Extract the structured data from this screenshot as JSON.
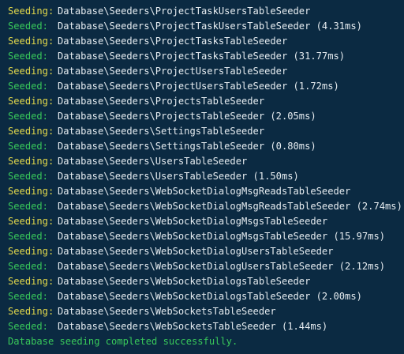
{
  "terminal": {
    "lines": [
      {
        "status": "Seeding:",
        "type": "seeding",
        "text": "Database\\Seeders\\ProjectTaskUsersTableSeeder"
      },
      {
        "status": "Seeded:",
        "type": "seeded",
        "text": "Database\\Seeders\\ProjectTaskUsersTableSeeder (4.31ms)"
      },
      {
        "status": "Seeding:",
        "type": "seeding",
        "text": "Database\\Seeders\\ProjectTasksTableSeeder"
      },
      {
        "status": "Seeded:",
        "type": "seeded",
        "text": "Database\\Seeders\\ProjectTasksTableSeeder (31.77ms)"
      },
      {
        "status": "Seeding:",
        "type": "seeding",
        "text": "Database\\Seeders\\ProjectUsersTableSeeder"
      },
      {
        "status": "Seeded:",
        "type": "seeded",
        "text": "Database\\Seeders\\ProjectUsersTableSeeder (1.72ms)"
      },
      {
        "status": "Seeding:",
        "type": "seeding",
        "text": "Database\\Seeders\\ProjectsTableSeeder"
      },
      {
        "status": "Seeded:",
        "type": "seeded",
        "text": "Database\\Seeders\\ProjectsTableSeeder (2.05ms)"
      },
      {
        "status": "Seeding:",
        "type": "seeding",
        "text": "Database\\Seeders\\SettingsTableSeeder"
      },
      {
        "status": "Seeded:",
        "type": "seeded",
        "text": "Database\\Seeders\\SettingsTableSeeder (0.80ms)"
      },
      {
        "status": "Seeding:",
        "type": "seeding",
        "text": "Database\\Seeders\\UsersTableSeeder"
      },
      {
        "status": "Seeded:",
        "type": "seeded",
        "text": "Database\\Seeders\\UsersTableSeeder (1.50ms)"
      },
      {
        "status": "Seeding:",
        "type": "seeding",
        "text": "Database\\Seeders\\WebSocketDialogMsgReadsTableSeeder"
      },
      {
        "status": "Seeded:",
        "type": "seeded",
        "text": "Database\\Seeders\\WebSocketDialogMsgReadsTableSeeder (2.74ms)"
      },
      {
        "status": "Seeding:",
        "type": "seeding",
        "text": "Database\\Seeders\\WebSocketDialogMsgsTableSeeder"
      },
      {
        "status": "Seeded:",
        "type": "seeded",
        "text": "Database\\Seeders\\WebSocketDialogMsgsTableSeeder (15.97ms)"
      },
      {
        "status": "Seeding:",
        "type": "seeding",
        "text": "Database\\Seeders\\WebSocketDialogUsersTableSeeder"
      },
      {
        "status": "Seeded:",
        "type": "seeded",
        "text": "Database\\Seeders\\WebSocketDialogUsersTableSeeder (2.12ms)"
      },
      {
        "status": "Seeding:",
        "type": "seeding",
        "text": "Database\\Seeders\\WebSocketDialogsTableSeeder"
      },
      {
        "status": "Seeded:",
        "type": "seeded",
        "text": "Database\\Seeders\\WebSocketDialogsTableSeeder (2.00ms)"
      },
      {
        "status": "Seeding:",
        "type": "seeding",
        "text": "Database\\Seeders\\WebSocketsTableSeeder"
      },
      {
        "status": "Seeded:",
        "type": "seeded",
        "text": "Database\\Seeders\\WebSocketsTableSeeder (1.44ms)"
      }
    ],
    "final_message": "Database seeding completed successfully.",
    "colors": {
      "background": "#0b2a42",
      "seeding": "#e3d84a",
      "seeded": "#39c95a",
      "text": "#e6ecf0"
    }
  }
}
